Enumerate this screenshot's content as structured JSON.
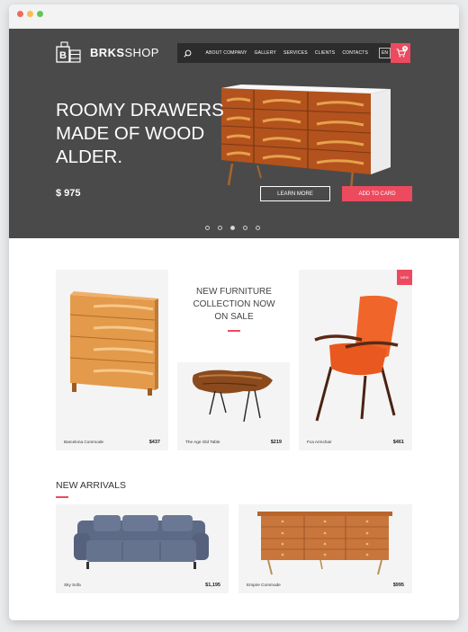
{
  "brand": {
    "name_bold": "BRKS",
    "name_regular": "SHOP"
  },
  "nav": {
    "items": [
      {
        "label": "About company"
      },
      {
        "label": "Gallery"
      },
      {
        "label": "Services"
      },
      {
        "label": "Clients"
      },
      {
        "label": "Contacts"
      }
    ],
    "lang": "EN",
    "cart_count": "0",
    "icons": {
      "search": "search-icon",
      "cart": "cart-icon"
    }
  },
  "hero": {
    "title_lines": [
      "ROOMY DRAWERS",
      "MADE OF WOOD",
      "ALDER."
    ],
    "price": "$ 975",
    "learn_more": "LEARN MORE",
    "add_to_card": "ADD TO CARD",
    "slides": 5,
    "active_slide": 3
  },
  "promo": {
    "lines": [
      "NEW FURNITURE",
      "COLLECTION NOW",
      "ON SALE"
    ]
  },
  "products": [
    {
      "name": "Barcelona Commode",
      "price": "$437"
    },
    {
      "name": "The Age Old Table",
      "price": "$219"
    },
    {
      "name": "Fca Armchair",
      "price": "$461",
      "badge": "NEW"
    }
  ],
  "arrivals": {
    "title": "NEW ARRIVALS",
    "items": [
      {
        "name": "Sky Sofa",
        "price": "$1,195"
      },
      {
        "name": "Empire Commode",
        "price": "$995"
      }
    ]
  },
  "colors": {
    "accent": "#ec4a5f",
    "hero_bg": "#4a4a4a",
    "nav_bg": "#2c2c2c",
    "card_bg": "#f4f4f4"
  }
}
